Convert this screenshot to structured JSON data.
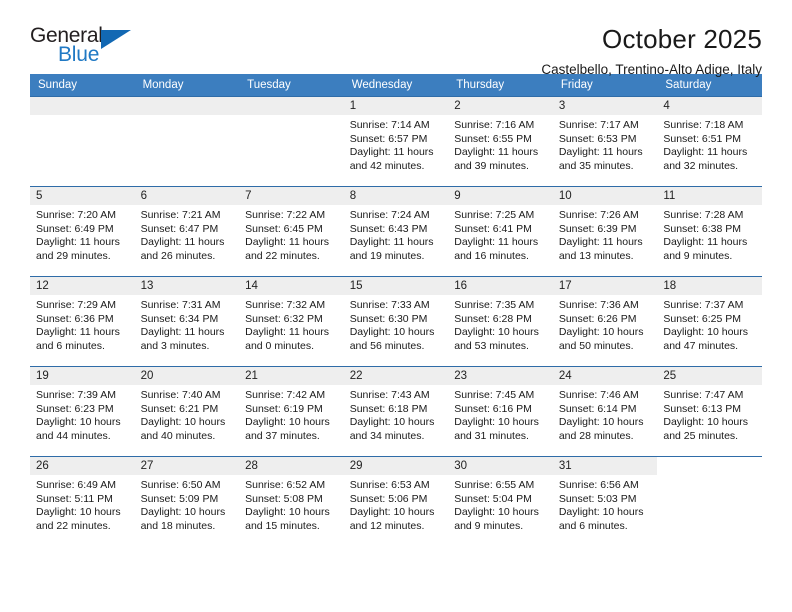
{
  "brand": {
    "name_top": "General",
    "name_bottom": "Blue",
    "color_dark": "#231f20",
    "color_blue": "#2079c4",
    "triangle_color": "#1268b3"
  },
  "header": {
    "title": "October 2025",
    "subtitle": "Castelbello, Trentino-Alto Adige, Italy",
    "header_bg": "#3c7ebf",
    "row_divider": "#2f6ca8",
    "daybar_bg": "#eeeeee"
  },
  "weekday_headers": [
    "Sunday",
    "Monday",
    "Tuesday",
    "Wednesday",
    "Thursday",
    "Friday",
    "Saturday"
  ],
  "weeks": [
    [
      {
        "day": "",
        "sunrise": "",
        "sunset": "",
        "daylight_line1": "",
        "daylight_line2": "",
        "empty": true
      },
      {
        "day": "",
        "sunrise": "",
        "sunset": "",
        "daylight_line1": "",
        "daylight_line2": "",
        "empty": true
      },
      {
        "day": "",
        "sunrise": "",
        "sunset": "",
        "daylight_line1": "",
        "daylight_line2": "",
        "empty": true
      },
      {
        "day": "1",
        "sunrise": "Sunrise: 7:14 AM",
        "sunset": "Sunset: 6:57 PM",
        "daylight_line1": "Daylight: 11 hours",
        "daylight_line2": "and 42 minutes."
      },
      {
        "day": "2",
        "sunrise": "Sunrise: 7:16 AM",
        "sunset": "Sunset: 6:55 PM",
        "daylight_line1": "Daylight: 11 hours",
        "daylight_line2": "and 39 minutes."
      },
      {
        "day": "3",
        "sunrise": "Sunrise: 7:17 AM",
        "sunset": "Sunset: 6:53 PM",
        "daylight_line1": "Daylight: 11 hours",
        "daylight_line2": "and 35 minutes."
      },
      {
        "day": "4",
        "sunrise": "Sunrise: 7:18 AM",
        "sunset": "Sunset: 6:51 PM",
        "daylight_line1": "Daylight: 11 hours",
        "daylight_line2": "and 32 minutes."
      }
    ],
    [
      {
        "day": "5",
        "sunrise": "Sunrise: 7:20 AM",
        "sunset": "Sunset: 6:49 PM",
        "daylight_line1": "Daylight: 11 hours",
        "daylight_line2": "and 29 minutes."
      },
      {
        "day": "6",
        "sunrise": "Sunrise: 7:21 AM",
        "sunset": "Sunset: 6:47 PM",
        "daylight_line1": "Daylight: 11 hours",
        "daylight_line2": "and 26 minutes."
      },
      {
        "day": "7",
        "sunrise": "Sunrise: 7:22 AM",
        "sunset": "Sunset: 6:45 PM",
        "daylight_line1": "Daylight: 11 hours",
        "daylight_line2": "and 22 minutes."
      },
      {
        "day": "8",
        "sunrise": "Sunrise: 7:24 AM",
        "sunset": "Sunset: 6:43 PM",
        "daylight_line1": "Daylight: 11 hours",
        "daylight_line2": "and 19 minutes."
      },
      {
        "day": "9",
        "sunrise": "Sunrise: 7:25 AM",
        "sunset": "Sunset: 6:41 PM",
        "daylight_line1": "Daylight: 11 hours",
        "daylight_line2": "and 16 minutes."
      },
      {
        "day": "10",
        "sunrise": "Sunrise: 7:26 AM",
        "sunset": "Sunset: 6:39 PM",
        "daylight_line1": "Daylight: 11 hours",
        "daylight_line2": "and 13 minutes."
      },
      {
        "day": "11",
        "sunrise": "Sunrise: 7:28 AM",
        "sunset": "Sunset: 6:38 PM",
        "daylight_line1": "Daylight: 11 hours",
        "daylight_line2": "and 9 minutes."
      }
    ],
    [
      {
        "day": "12",
        "sunrise": "Sunrise: 7:29 AM",
        "sunset": "Sunset: 6:36 PM",
        "daylight_line1": "Daylight: 11 hours",
        "daylight_line2": "and 6 minutes."
      },
      {
        "day": "13",
        "sunrise": "Sunrise: 7:31 AM",
        "sunset": "Sunset: 6:34 PM",
        "daylight_line1": "Daylight: 11 hours",
        "daylight_line2": "and 3 minutes."
      },
      {
        "day": "14",
        "sunrise": "Sunrise: 7:32 AM",
        "sunset": "Sunset: 6:32 PM",
        "daylight_line1": "Daylight: 11 hours",
        "daylight_line2": "and 0 minutes."
      },
      {
        "day": "15",
        "sunrise": "Sunrise: 7:33 AM",
        "sunset": "Sunset: 6:30 PM",
        "daylight_line1": "Daylight: 10 hours",
        "daylight_line2": "and 56 minutes."
      },
      {
        "day": "16",
        "sunrise": "Sunrise: 7:35 AM",
        "sunset": "Sunset: 6:28 PM",
        "daylight_line1": "Daylight: 10 hours",
        "daylight_line2": "and 53 minutes."
      },
      {
        "day": "17",
        "sunrise": "Sunrise: 7:36 AM",
        "sunset": "Sunset: 6:26 PM",
        "daylight_line1": "Daylight: 10 hours",
        "daylight_line2": "and 50 minutes."
      },
      {
        "day": "18",
        "sunrise": "Sunrise: 7:37 AM",
        "sunset": "Sunset: 6:25 PM",
        "daylight_line1": "Daylight: 10 hours",
        "daylight_line2": "and 47 minutes."
      }
    ],
    [
      {
        "day": "19",
        "sunrise": "Sunrise: 7:39 AM",
        "sunset": "Sunset: 6:23 PM",
        "daylight_line1": "Daylight: 10 hours",
        "daylight_line2": "and 44 minutes."
      },
      {
        "day": "20",
        "sunrise": "Sunrise: 7:40 AM",
        "sunset": "Sunset: 6:21 PM",
        "daylight_line1": "Daylight: 10 hours",
        "daylight_line2": "and 40 minutes."
      },
      {
        "day": "21",
        "sunrise": "Sunrise: 7:42 AM",
        "sunset": "Sunset: 6:19 PM",
        "daylight_line1": "Daylight: 10 hours",
        "daylight_line2": "and 37 minutes."
      },
      {
        "day": "22",
        "sunrise": "Sunrise: 7:43 AM",
        "sunset": "Sunset: 6:18 PM",
        "daylight_line1": "Daylight: 10 hours",
        "daylight_line2": "and 34 minutes."
      },
      {
        "day": "23",
        "sunrise": "Sunrise: 7:45 AM",
        "sunset": "Sunset: 6:16 PM",
        "daylight_line1": "Daylight: 10 hours",
        "daylight_line2": "and 31 minutes."
      },
      {
        "day": "24",
        "sunrise": "Sunrise: 7:46 AM",
        "sunset": "Sunset: 6:14 PM",
        "daylight_line1": "Daylight: 10 hours",
        "daylight_line2": "and 28 minutes."
      },
      {
        "day": "25",
        "sunrise": "Sunrise: 7:47 AM",
        "sunset": "Sunset: 6:13 PM",
        "daylight_line1": "Daylight: 10 hours",
        "daylight_line2": "and 25 minutes."
      }
    ],
    [
      {
        "day": "26",
        "sunrise": "Sunrise: 6:49 AM",
        "sunset": "Sunset: 5:11 PM",
        "daylight_line1": "Daylight: 10 hours",
        "daylight_line2": "and 22 minutes."
      },
      {
        "day": "27",
        "sunrise": "Sunrise: 6:50 AM",
        "sunset": "Sunset: 5:09 PM",
        "daylight_line1": "Daylight: 10 hours",
        "daylight_line2": "and 18 minutes."
      },
      {
        "day": "28",
        "sunrise": "Sunrise: 6:52 AM",
        "sunset": "Sunset: 5:08 PM",
        "daylight_line1": "Daylight: 10 hours",
        "daylight_line2": "and 15 minutes."
      },
      {
        "day": "29",
        "sunrise": "Sunrise: 6:53 AM",
        "sunset": "Sunset: 5:06 PM",
        "daylight_line1": "Daylight: 10 hours",
        "daylight_line2": "and 12 minutes."
      },
      {
        "day": "30",
        "sunrise": "Sunrise: 6:55 AM",
        "sunset": "Sunset: 5:04 PM",
        "daylight_line1": "Daylight: 10 hours",
        "daylight_line2": "and 9 minutes."
      },
      {
        "day": "31",
        "sunrise": "Sunrise: 6:56 AM",
        "sunset": "Sunset: 5:03 PM",
        "daylight_line1": "Daylight: 10 hours",
        "daylight_line2": "and 6 minutes."
      },
      {
        "day": "",
        "sunrise": "",
        "sunset": "",
        "daylight_line1": "",
        "daylight_line2": "",
        "blank": true
      }
    ]
  ]
}
